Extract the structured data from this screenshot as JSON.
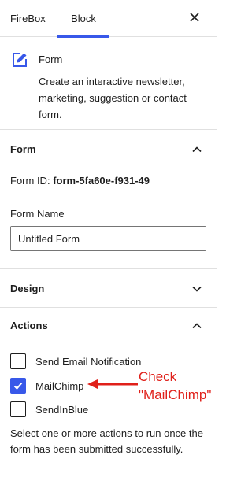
{
  "tabs": [
    {
      "label": "FireBox",
      "active": false
    },
    {
      "label": "Block",
      "active": true
    }
  ],
  "accent_color": "#3858e9",
  "annotation_color": "#e0201a",
  "block": {
    "icon": "edit-form-icon",
    "title": "Form",
    "description": "Create an interactive newsletter, marketing, suggestion or contact form."
  },
  "form_panel": {
    "title": "Form",
    "expanded": true,
    "form_id_label": "Form ID:",
    "form_id_value": "form-5fa60e-f931-49",
    "form_name_label": "Form Name",
    "form_name_value": "Untitled Form"
  },
  "design_panel": {
    "title": "Design",
    "expanded": false
  },
  "actions_panel": {
    "title": "Actions",
    "expanded": true,
    "options": [
      {
        "label": "Send Email Notification",
        "checked": false
      },
      {
        "label": "MailChimp",
        "checked": true
      },
      {
        "label": "SendInBlue",
        "checked": false
      }
    ],
    "help": "Select one or more actions to run once the form has been submitted successfully."
  },
  "annotation": {
    "line1": "Check",
    "line2": "\"MailChimp\""
  }
}
